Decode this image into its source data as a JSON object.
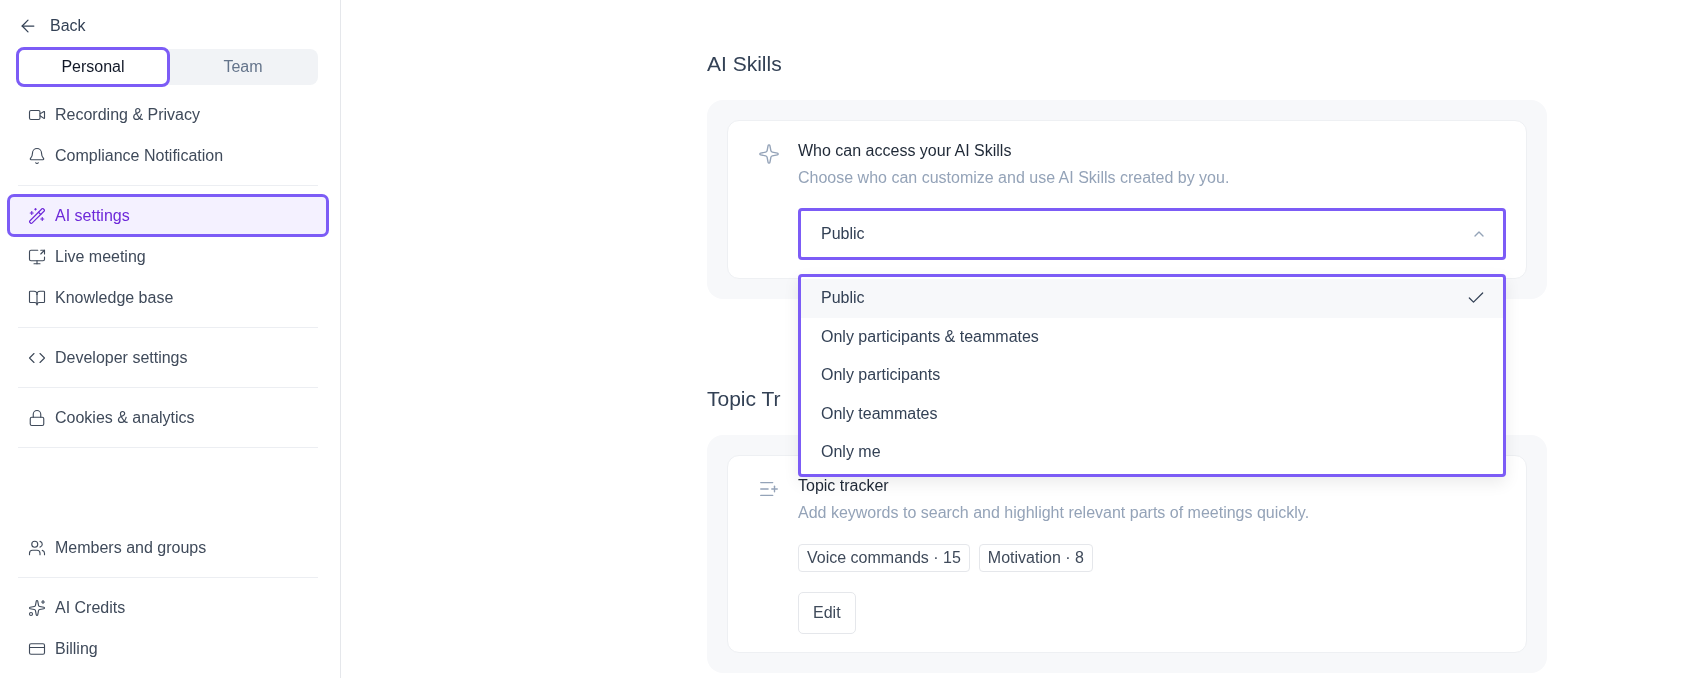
{
  "sidebar": {
    "back": "Back",
    "tabs": [
      {
        "label": "Personal",
        "selected": true
      },
      {
        "label": "Team",
        "selected": false
      }
    ],
    "groups": [
      [
        {
          "label": "Recording & Privacy",
          "selected": false
        },
        {
          "label": "Compliance Notification",
          "selected": false
        }
      ],
      [
        {
          "label": "AI settings",
          "selected": true
        },
        {
          "label": "Live meeting",
          "selected": false
        },
        {
          "label": "Knowledge base",
          "selected": false
        }
      ],
      [
        {
          "label": "Developer settings",
          "selected": false
        }
      ],
      [
        {
          "label": "Cookies & analytics",
          "selected": false
        }
      ]
    ],
    "bottom_groups": [
      [
        {
          "label": "Members and groups",
          "selected": false
        }
      ],
      [
        {
          "label": "AI Credits",
          "selected": false
        },
        {
          "label": "Billing",
          "selected": false
        }
      ]
    ]
  },
  "sections": [
    {
      "heading": "AI Skills",
      "title": "Who can access your AI Skills",
      "description": "Choose who can customize and use AI Skills created by you.",
      "select": {
        "value": "Public",
        "expanded": true,
        "options": [
          {
            "label": "Public",
            "selected": true
          },
          {
            "label": "Only participants & teammates",
            "selected": false
          },
          {
            "label": "Only participants",
            "selected": false
          },
          {
            "label": "Only teammates",
            "selected": false
          },
          {
            "label": "Only me",
            "selected": false
          }
        ]
      }
    },
    {
      "heading": "Topic Tr",
      "title": "Topic tracker",
      "description": "Add keywords to search and highlight relevant parts of meetings quickly.",
      "tags": [
        "Voice commands · 15",
        "Motivation · 8"
      ],
      "button": "Edit"
    }
  ]
}
